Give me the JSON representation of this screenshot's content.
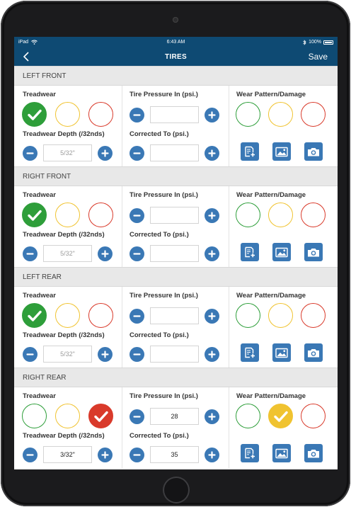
{
  "status_bar": {
    "carrier": "iPad",
    "time": "6:43 AM",
    "battery": "100%",
    "wifi_icon": "wifi-icon",
    "bluetooth_icon": "bluetooth-icon"
  },
  "nav": {
    "title": "TIRES",
    "save_label": "Save",
    "back_icon": "chevron-left-icon"
  },
  "labels": {
    "treadwear": "Treadwear",
    "treadwear_depth": "Treadwear Depth (/32nds)",
    "tire_pressure_in": "Tire Pressure In (psi.)",
    "corrected_to": "Corrected To (psi.)",
    "wear_pattern": "Wear Pattern/Damage"
  },
  "colors": {
    "nav_blue": "#0e4a73",
    "button_blue": "#3a78b5",
    "green": "#2e9e3a",
    "yellow": "#f0c330",
    "red": "#d93a2b"
  },
  "tires": [
    {
      "name": "LEFT FRONT",
      "treadwear_selected": "green",
      "tread_depth": {
        "value": "",
        "placeholder": "5/32\""
      },
      "pressure_in": "",
      "corrected_to": "",
      "wear_selected": "none"
    },
    {
      "name": "RIGHT FRONT",
      "treadwear_selected": "green",
      "tread_depth": {
        "value": "",
        "placeholder": "5/32\""
      },
      "pressure_in": "",
      "corrected_to": "",
      "wear_selected": "none"
    },
    {
      "name": "LEFT REAR",
      "treadwear_selected": "green",
      "tread_depth": {
        "value": "",
        "placeholder": "5/32\""
      },
      "pressure_in": "",
      "corrected_to": "",
      "wear_selected": "none"
    },
    {
      "name": "RIGHT REAR",
      "treadwear_selected": "red",
      "tread_depth": {
        "value": "3/32\"",
        "placeholder": ""
      },
      "pressure_in": "28",
      "corrected_to": "35",
      "wear_selected": "yellow"
    }
  ],
  "action_icons": [
    "add-note-icon",
    "image-icon",
    "camera-icon"
  ]
}
